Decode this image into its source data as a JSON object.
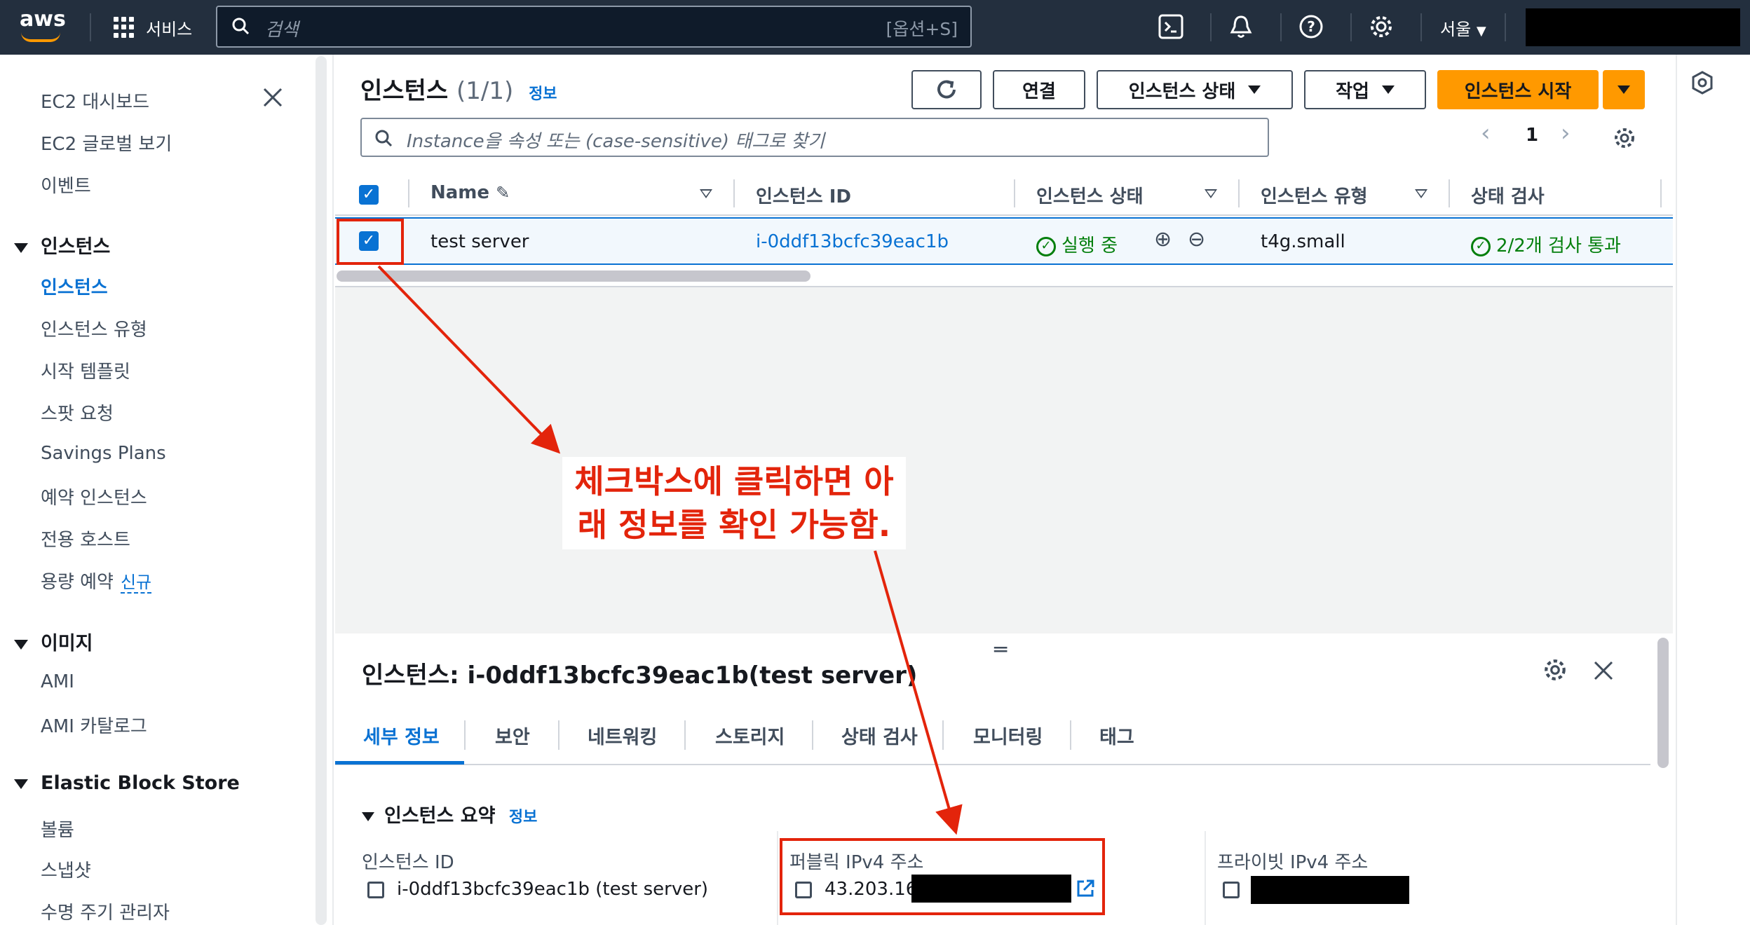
{
  "topnav": {
    "logo": "aws",
    "services_label": "서비스",
    "search_placeholder": "검색",
    "search_shortcut": "[옵션+S]",
    "region": "서울",
    "icons": [
      "cloudshell-icon",
      "bell-icon",
      "help-icon",
      "settings-icon"
    ]
  },
  "sidebar": {
    "top_items": [
      "EC2 대시보드",
      "EC2 글로벌 보기",
      "이벤트"
    ],
    "sections": [
      {
        "title": "인스턴스",
        "items": [
          "인스턴스",
          "인스턴스 유형",
          "시작 템플릿",
          "스팟 요청",
          "Savings Plans",
          "예약 인스턴스",
          "전용 호스트",
          "용량 예약"
        ]
      },
      {
        "title": "이미지",
        "items": [
          "AMI",
          "AMI 카탈로그"
        ]
      },
      {
        "title": "Elastic Block Store",
        "items": [
          "볼륨",
          "스냅샷",
          "수명 주기 관리자"
        ]
      }
    ],
    "active_item": "인스턴스",
    "new_badge": "신규"
  },
  "main": {
    "title": "인스턴스",
    "count": "(1/1)",
    "info": "정보",
    "buttons": {
      "connect": "연결",
      "state": "인스턴스 상태",
      "actions": "작업",
      "launch": "인스턴스 시작"
    },
    "filter_placeholder": "Instance을 속성 또는 (case-sensitive) 태그로 찾기",
    "page": "1",
    "columns": [
      "Name",
      "인스턴스 ID",
      "인스턴스 상태",
      "인스턴스 유형",
      "상태 검사"
    ],
    "rows": [
      {
        "name": "test server",
        "id": "i-0ddf13bcfc39eac1b",
        "state": "실행 중",
        "type": "t4g.small",
        "check": "2/2개 검사 통과"
      }
    ]
  },
  "detail": {
    "title": "인스턴스: i-0ddf13bcfc39eac1b(test server)",
    "tabs": [
      "세부 정보",
      "보안",
      "네트워킹",
      "스토리지",
      "상태 검사",
      "모니터링",
      "태그"
    ],
    "active_tab": "세부 정보",
    "section": "인스턴스 요약",
    "section_info": "정보",
    "fields": [
      {
        "label": "인스턴스 ID",
        "value": "i-0ddf13bcfc39eac1b (test server)"
      },
      {
        "label": "퍼블릭 IPv4 주소",
        "value": "43.203.16"
      },
      {
        "label": "프라이빗 IPv4 주소",
        "value": ""
      }
    ]
  },
  "annotation": {
    "line1": "체크박스에 클릭하면 아",
    "line2": "래 정보를 확인 가능함.",
    "color": "#e3240b"
  }
}
